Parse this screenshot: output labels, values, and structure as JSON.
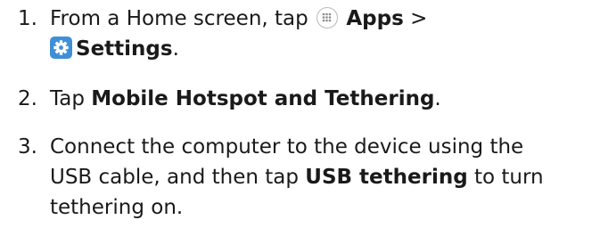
{
  "steps": [
    {
      "number": "1.",
      "segments": {
        "a": "From a Home screen, tap",
        "apps": "Apps",
        "gt": ">",
        "settings": "Settings",
        "end": "."
      },
      "icons": [
        "apps-grid-icon",
        "settings-gear-icon"
      ]
    },
    {
      "number": "2.",
      "segments": {
        "a": "Tap",
        "target": "Mobile Hotspot and Tethering",
        "end": "."
      }
    },
    {
      "number": "3.",
      "segments": {
        "l1": "Connect the computer to the device using the",
        "l2a": "USB cable, and then tap",
        "target": "USB tethering",
        "l2b": "to turn",
        "l3": "tethering on."
      }
    }
  ],
  "colors": {
    "text": "#1a1a1a",
    "settings_icon_bg": "#3f8fd8",
    "apps_icon_border": "#b9b9b9"
  }
}
